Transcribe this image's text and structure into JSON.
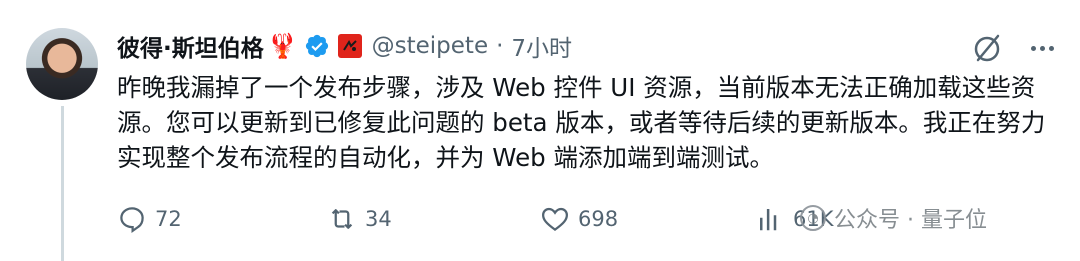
{
  "author": {
    "display_name": "彼得·斯坦伯格",
    "emoji": "🦞",
    "handle": "@steipete",
    "separator": "·",
    "time": "7小时"
  },
  "tweet": {
    "text": "昨晚我漏掉了一个发布步骤，涉及 Web 控件 UI 资源，当前版本无法正确加载这些资源。您可以更新到已修复此问题的 beta 版本，或者等待后续的更新版本。我正在努力实现整个发布流程的自动化，并为 Web 端添加端到端测试。"
  },
  "actions": {
    "replies": "72",
    "retweets": "34",
    "likes": "698",
    "views": "61K"
  },
  "watermark": {
    "text": "公众号 · 量子位"
  },
  "colors": {
    "text_primary": "#0f1419",
    "text_secondary": "#536471",
    "verified_blue": "#1d9bf0",
    "affiliate_red": "#e0241b"
  },
  "icons": [
    "verified-icon",
    "affiliate-badge-icon",
    "grok-icon",
    "more-icon",
    "reply-icon",
    "retweet-icon",
    "like-icon",
    "views-icon"
  ]
}
